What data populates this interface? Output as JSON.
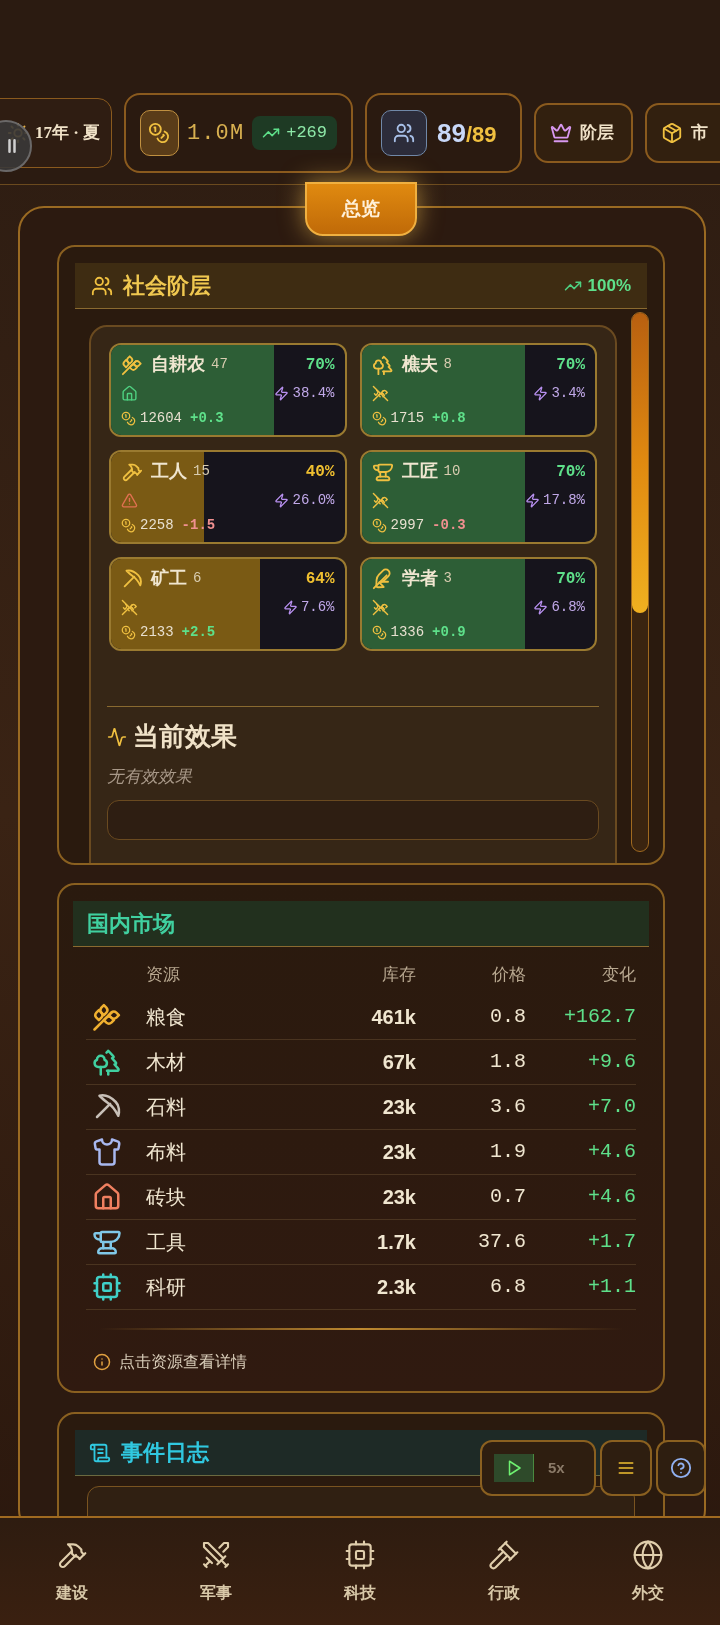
{
  "top_bar": {
    "date": "17年 · 夏",
    "treasury": {
      "amount": "1.0M",
      "income": "+269"
    },
    "population": {
      "current": "89",
      "capacity": "/89"
    },
    "buttons": [
      {
        "label": "阶层"
      },
      {
        "label": "市"
      }
    ]
  },
  "overview_tab": {
    "label": "总览",
    "selected": true
  },
  "classes_panel": {
    "title": "社会阶层",
    "approval": "100%",
    "classes": [
      {
        "name": "自耕农",
        "count": "47",
        "approval": "70%",
        "level": 0.7,
        "housed": true,
        "alert": false,
        "influence": "38.4%",
        "wealth": "12604",
        "change": "+0.3",
        "falling": false
      },
      {
        "name": "樵夫",
        "count": "8",
        "approval": "70%",
        "level": 0.7,
        "housed": false,
        "alert": false,
        "influence": "3.4%",
        "wealth": "1715",
        "change": "+0.8",
        "falling": false
      },
      {
        "name": "工人",
        "count": "15",
        "approval": "40%",
        "level": 0.4,
        "housed": false,
        "alert": true,
        "influence": "26.0%",
        "wealth": "2258",
        "change": "-1.5",
        "falling": true
      },
      {
        "name": "工匠",
        "count": "10",
        "approval": "70%",
        "level": 0.7,
        "housed": false,
        "alert": false,
        "influence": "17.8%",
        "wealth": "2997",
        "change": "-0.3",
        "falling": true
      },
      {
        "name": "矿工",
        "count": "6",
        "approval": "64%",
        "level": 0.64,
        "housed": false,
        "alert": false,
        "influence": "7.6%",
        "wealth": "2133",
        "change": "+2.5",
        "falling": false
      },
      {
        "name": "学者",
        "count": "3",
        "approval": "70%",
        "level": 0.7,
        "housed": false,
        "alert": false,
        "influence": "6.8%",
        "wealth": "1336",
        "change": "+0.9",
        "falling": false
      }
    ],
    "effects": {
      "title": "当前效果",
      "empty_text": "无有效效果"
    }
  },
  "market": {
    "title": "国内市场",
    "columns": [
      "资源",
      "库存",
      "价格",
      "变化"
    ],
    "rows": [
      {
        "name": "粮食",
        "stock": "461k",
        "price": "0.8",
        "change": "+162.7"
      },
      {
        "name": "木材",
        "stock": "67k",
        "price": "1.8",
        "change": "+9.6"
      },
      {
        "name": "石料",
        "stock": "23k",
        "price": "3.6",
        "change": "+7.0"
      },
      {
        "name": "布料",
        "stock": "23k",
        "price": "1.9",
        "change": "+4.6"
      },
      {
        "name": "砖块",
        "stock": "23k",
        "price": "0.7",
        "change": "+4.6"
      },
      {
        "name": "工具",
        "stock": "1.7k",
        "price": "37.6",
        "change": "+1.7"
      },
      {
        "name": "科研",
        "stock": "2.3k",
        "price": "6.8",
        "change": "+1.1"
      }
    ],
    "hint": "点击资源查看详情"
  },
  "event_log": {
    "title": "事件日志"
  },
  "controls": {
    "speed": "5x"
  },
  "bottom_nav": [
    {
      "label": "建设"
    },
    {
      "label": "军事"
    },
    {
      "label": "科技"
    },
    {
      "label": "行政"
    },
    {
      "label": "外交"
    }
  ]
}
